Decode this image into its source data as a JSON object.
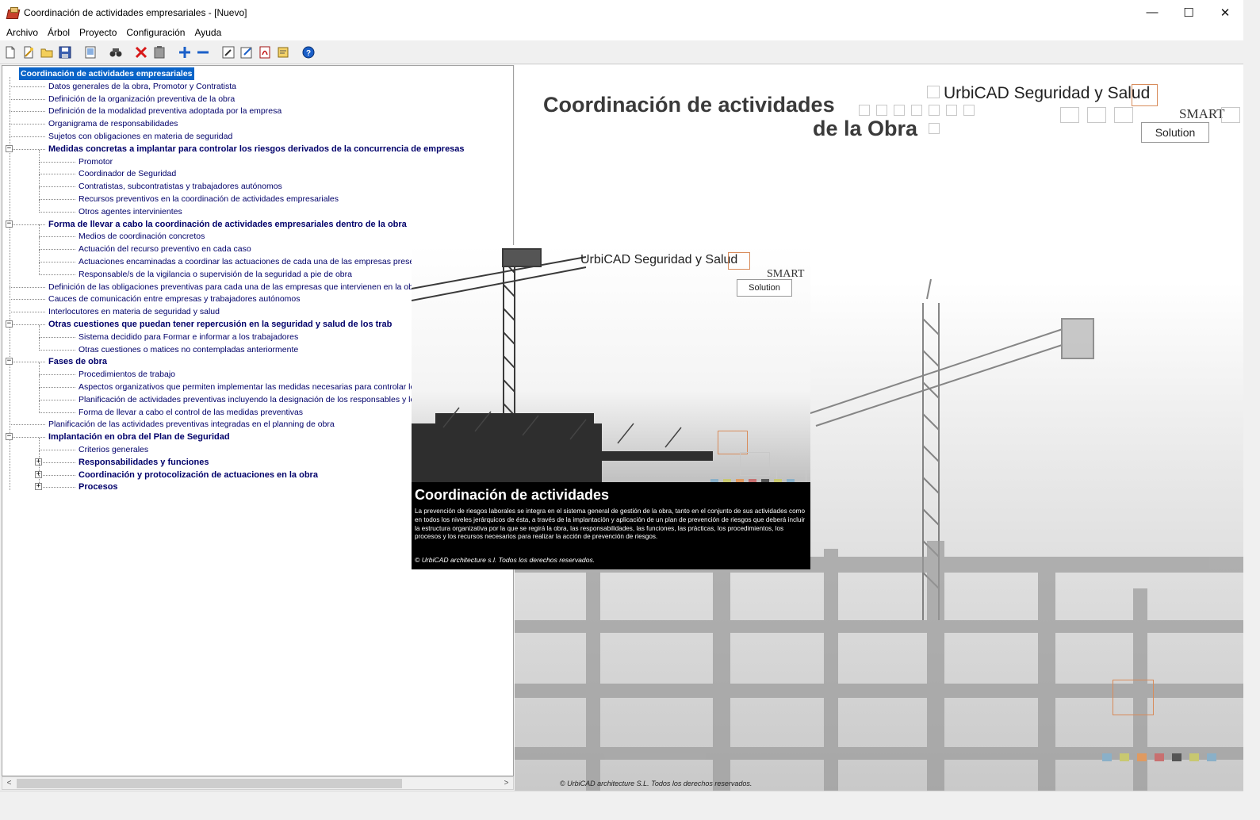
{
  "window": {
    "title": "Coordinación de actividades empresariales - [Nuevo]",
    "controls": {
      "minimize": "—",
      "maximize": "☐",
      "close": "✕"
    }
  },
  "menu": [
    "Archivo",
    "Árbol",
    "Proyecto",
    "Configuración",
    "Ayuda"
  ],
  "toolbar": {
    "icons": [
      "new-document-icon",
      "wizard-icon",
      "open-folder-icon",
      "save-icon",
      "preview-icon",
      "find-icon",
      "delete-icon",
      "clipboard-icon",
      "expand-plus-icon",
      "collapse-minus-icon",
      "edit-tool-icon",
      "edit-note-icon",
      "pdf-icon",
      "report-icon",
      "help-icon"
    ]
  },
  "tree": {
    "root": "Coordinación de actividades empresariales",
    "nodes": [
      {
        "label": "Datos generales de la obra, Promotor y Contratista",
        "level": 1,
        "bold": false
      },
      {
        "label": "Definición de la organización preventiva de la obra",
        "level": 1,
        "bold": false
      },
      {
        "label": "Definición de la modalidad preventiva adoptada por la empresa",
        "level": 1,
        "bold": false
      },
      {
        "label": "Organigrama de responsabilidades",
        "level": 1,
        "bold": false
      },
      {
        "label": "Sujetos con obligaciones en materia de seguridad",
        "level": 1,
        "bold": false
      },
      {
        "label": "Medidas concretas a implantar para controlar los riesgos derivados de la concurrencia de empresas",
        "level": 1,
        "bold": true,
        "expander": "−"
      },
      {
        "label": "Promotor",
        "level": 2,
        "bold": false
      },
      {
        "label": "Coordinador de Seguridad",
        "level": 2,
        "bold": false
      },
      {
        "label": "Contratistas, subcontratistas y trabajadores autónomos",
        "level": 2,
        "bold": false
      },
      {
        "label": "Recursos preventivos en la coordinación de actividades empresariales",
        "level": 2,
        "bold": false
      },
      {
        "label": "Otros agentes intervinientes",
        "level": 2,
        "bold": false
      },
      {
        "label": "Forma de llevar a cabo la coordinación de actividades empresariales dentro de la obra",
        "level": 1,
        "bold": true,
        "expander": "−"
      },
      {
        "label": "Medios de coordinación concretos",
        "level": 2,
        "bold": false
      },
      {
        "label": "Actuación del recurso preventivo en cada caso",
        "level": 2,
        "bold": false
      },
      {
        "label": "Actuaciones encaminadas a coordinar las actuaciones de cada una de las empresas prese",
        "level": 2,
        "bold": false
      },
      {
        "label": "Responsable/s de la vigilancia o supervisión de la seguridad a pie de obra",
        "level": 2,
        "bold": false
      },
      {
        "label": "Definición de las obligaciones preventivas para cada una de las empresas que intervienen en la ob",
        "level": 1,
        "bold": false
      },
      {
        "label": "Cauces de comunicación entre empresas y trabajadores autónomos",
        "level": 1,
        "bold": false
      },
      {
        "label": "Interlocutores en materia de seguridad y salud",
        "level": 1,
        "bold": false
      },
      {
        "label": "Otras cuestiones que puedan tener repercusión en la seguridad y salud de los trab",
        "level": 1,
        "bold": true,
        "expander": "−"
      },
      {
        "label": "Sistema decidido para Formar e informar a los trabajadores",
        "level": 2,
        "bold": false
      },
      {
        "label": "Otras cuestiones o matices no contempladas anteriormente",
        "level": 2,
        "bold": false
      },
      {
        "label": "Fases de obra",
        "level": 1,
        "bold": true,
        "expander": "−"
      },
      {
        "label": "Procedimientos de trabajo",
        "level": 2,
        "bold": false
      },
      {
        "label": "Aspectos organizativos que permiten implementar las medidas necesarias para controlar los",
        "level": 2,
        "bold": false
      },
      {
        "label": "Planificación de actividades preventivas incluyendo la designación de los responsables y lo",
        "level": 2,
        "bold": false
      },
      {
        "label": "Forma de llevar a cabo el control de las medidas preventivas",
        "level": 2,
        "bold": false
      },
      {
        "label": "Planificación de las actividades preventivas integradas en el planning de obra",
        "level": 1,
        "bold": false
      },
      {
        "label": "Implantación en obra del Plan de Seguridad",
        "level": 1,
        "bold": true,
        "expander": "−"
      },
      {
        "label": "Criterios generales",
        "level": 2,
        "bold": false
      },
      {
        "label": "Responsabilidades y funciones",
        "level": 2,
        "bold": true,
        "expander": "+"
      },
      {
        "label": "Coordinación y protocolización de actuaciones en la obra",
        "level": 2,
        "bold": true,
        "expander": "+"
      },
      {
        "label": "Procesos",
        "level": 2,
        "bold": true,
        "expander": "+"
      }
    ]
  },
  "scroll": {
    "left": "<",
    "right": ">"
  },
  "background": {
    "title_line1": "Coordinación de actividades",
    "title_line2": "de la Obra",
    "brand": "UrbiCAD Seguridad y Salud",
    "smart": "SMART",
    "solution": "Solution",
    "copyright": "©  UrbiCAD architecture S.L. Todos los derechos reservados."
  },
  "splash": {
    "brand": "UrbiCAD Seguridad y Salud",
    "smart": "SMART",
    "solution": "Solution",
    "title": "Coordinación de actividades",
    "text": "La prevención de riesgos laborales  se integra en el sistema general de gestión de la  obra, tanto en el conjunto de sus actividades como en todos los niveles jerárquicos de ésta, a través de la implantación y aplicación de un plan de prevención de riesgos que deberá incluir la estructura organizativa por la que se regirá la obra, las responsabilidades, las funciones, las prácticas, los procedimientos, los procesos y los recursos necesarios para realizar la acción de prevención de riesgos.",
    "copyright": "©  UrbiCAD architecture s.l. Todos los derechos reservados."
  },
  "colors": {
    "tree_text": "#00006a",
    "selection": "#0a64c8",
    "accent_orange": "#d88b5a"
  }
}
